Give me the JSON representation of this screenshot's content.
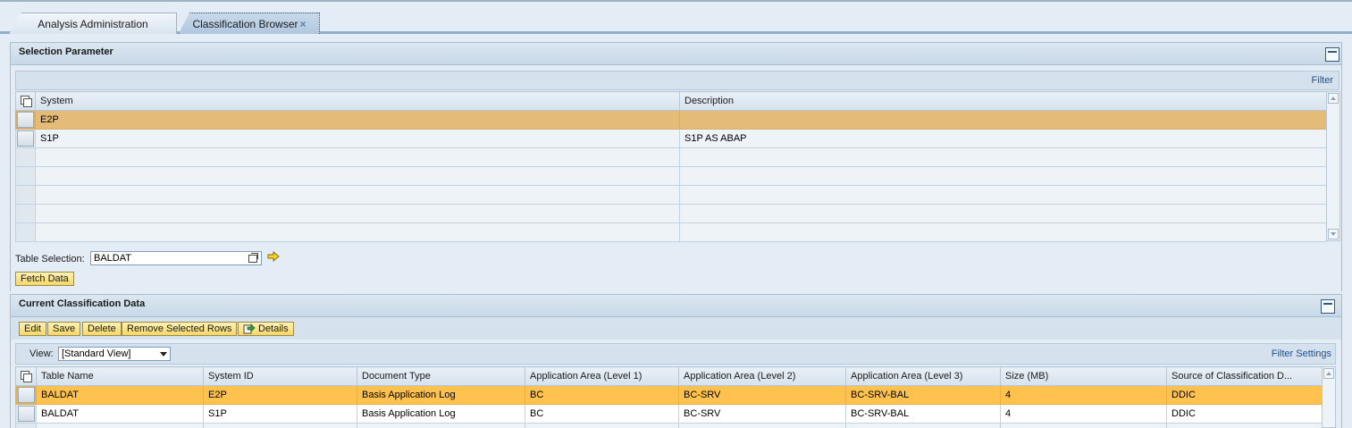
{
  "tabs": [
    {
      "label": "Analysis Administration",
      "active": false
    },
    {
      "label": "Classification Browser",
      "active": true,
      "close_symbol": "×"
    }
  ],
  "selection_parameter": {
    "title": "Selection Parameter",
    "filter_link": "Filter",
    "columns": [
      "System",
      "Description"
    ],
    "rows": [
      {
        "system": "E2P",
        "description": "",
        "selected": true
      },
      {
        "system": "S1P",
        "description": "S1P AS ABAP",
        "selected": false
      },
      {
        "system": "",
        "description": ""
      },
      {
        "system": "",
        "description": ""
      },
      {
        "system": "",
        "description": ""
      },
      {
        "system": "",
        "description": ""
      },
      {
        "system": "",
        "description": ""
      }
    ]
  },
  "table_selection": {
    "label": "Table Selection:",
    "value": "BALDAT"
  },
  "fetch_button": "Fetch Data",
  "current_classification": {
    "title": "Current Classification Data",
    "buttons": {
      "edit": "Edit",
      "save": "Save",
      "delete": "Delete",
      "remove": "Remove Selected Rows",
      "details": "Details"
    },
    "view_label": "View:",
    "view_value": "[Standard View]",
    "filter_settings_link": "Filter Settings",
    "columns": [
      "Table Name",
      "System ID",
      "Document Type",
      "Application Area (Level 1)",
      "Application Area (Level 2)",
      "Application Area (Level 3)",
      "Size (MB)",
      "Source of Classification D..."
    ],
    "rows": [
      {
        "cells": [
          "BALDAT",
          "E2P",
          "Basis Application Log",
          "BC",
          "BC-SRV",
          "BC-SRV-BAL",
          "4",
          "DDIC"
        ],
        "selected": true
      },
      {
        "cells": [
          "BALDAT",
          "S1P",
          "Basis Application Log",
          "BC",
          "BC-SRV",
          "BC-SRV-BAL",
          "4",
          "DDIC"
        ],
        "selected": false
      }
    ]
  },
  "colors": {
    "selected_row_1": "#e5bc77",
    "selected_row_2": "#ffc24f",
    "button_yellow": "#f6d766",
    "link_blue": "#1d4f91",
    "background": "#e4edf5"
  }
}
